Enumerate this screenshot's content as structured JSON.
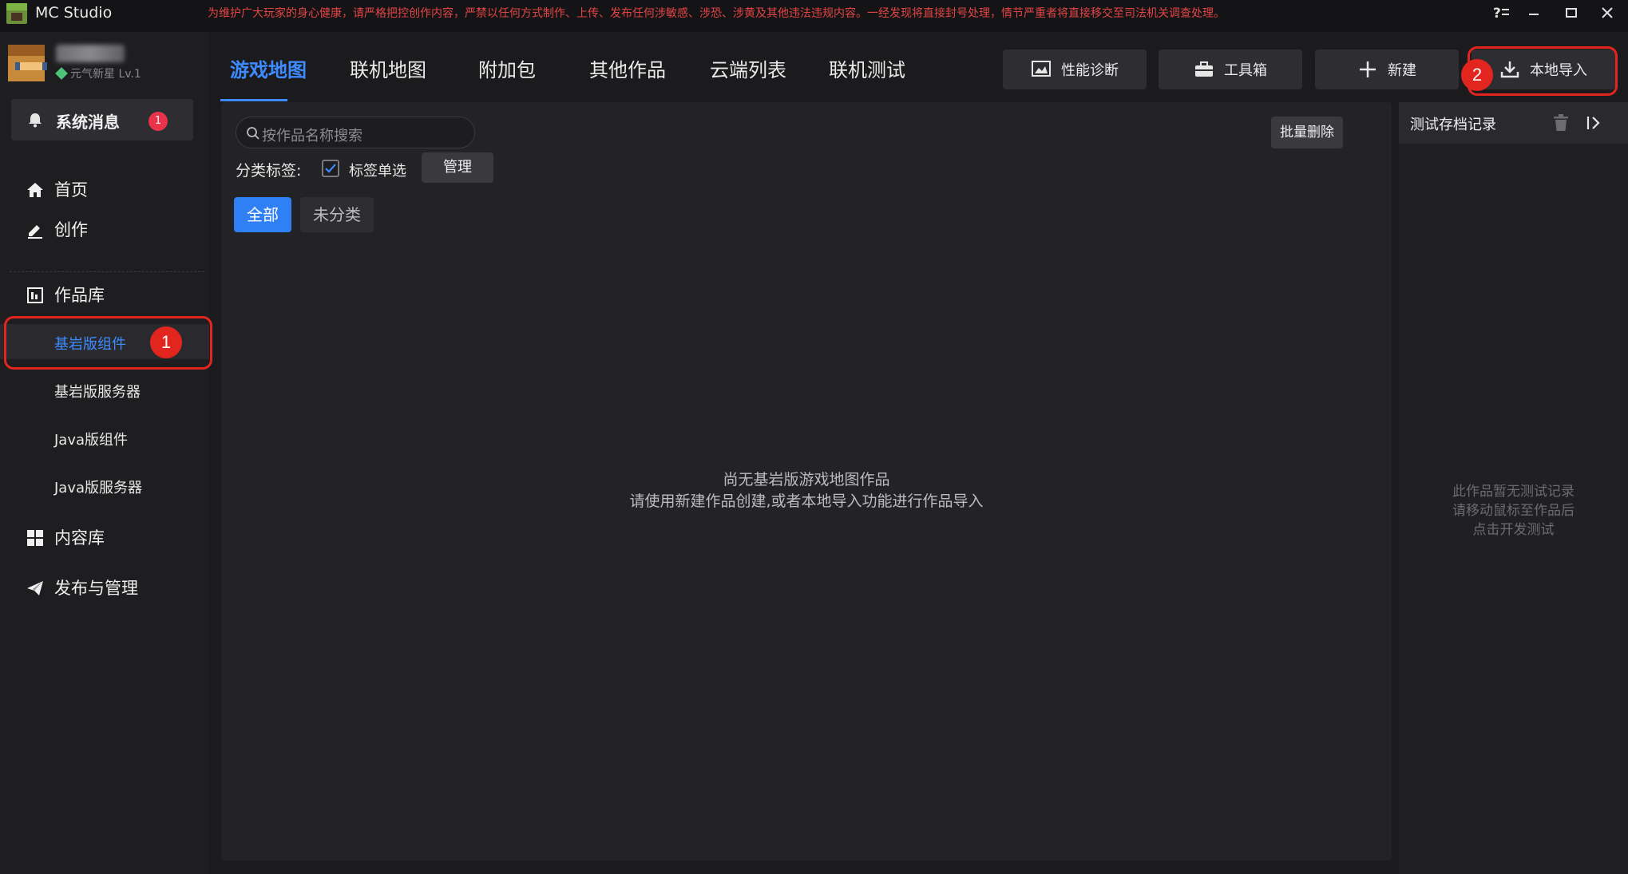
{
  "app": {
    "name": "MC Studio",
    "notice": "为维护广大玩家的身心健康，请严格把控创作内容，严禁以任何方式制作、上传、发布任何涉敏感、涉恐、涉黄及其他违法违规内容。一经发现将直接封号处理，情节严重者将直接移交至司法机关调查处理。"
  },
  "user": {
    "level": "元气新星 Lv.1"
  },
  "messages": {
    "label": "系统消息",
    "count": "1"
  },
  "sidebar": {
    "home": "首页",
    "create": "创作",
    "library": "作品库",
    "library_items": [
      "基岩版组件",
      "基岩版服务器",
      "Java版组件",
      "Java版服务器"
    ],
    "content": "内容库",
    "publish": "发布与管理"
  },
  "tabs": [
    "游戏地图",
    "联机地图",
    "附加包",
    "其他作品",
    "云端列表",
    "联机测试"
  ],
  "toolbar": {
    "diagnose": "性能诊断",
    "toolbox": "工具箱",
    "new": "新建",
    "import": "本地导入"
  },
  "annotations": {
    "step1": "1",
    "step2": "2",
    "highlight_color": "#e3251f"
  },
  "main": {
    "search_placeholder": "按作品名称搜索",
    "batch_delete": "批量删除",
    "category_label": "分类标签:",
    "single_select": "标签单选",
    "manage": "管理",
    "chips": [
      "全部",
      "未分类"
    ],
    "empty_line1": "尚无基岩版游戏地图作品",
    "empty_line2": "请使用新建作品创建,或者本地导入功能进行作品导入"
  },
  "right_panel": {
    "title": "测试存档记录",
    "empty_line1": "此作品暂无测试记录",
    "empty_line2": "请移动鼠标至作品后",
    "empty_line3": "点击开发测试"
  },
  "colors": {
    "accent": "#3d8bff",
    "badge": "#e8334a",
    "notice": "#e34545"
  }
}
